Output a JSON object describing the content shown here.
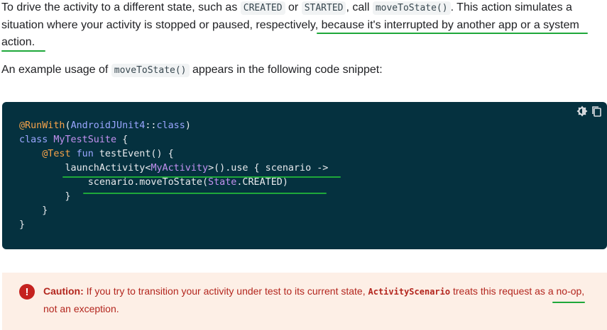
{
  "para1": {
    "t1": "To drive the activity to a different state, such as ",
    "code1": "CREATED",
    "t2": " or ",
    "code2": "STARTED",
    "t3": ", call ",
    "code3": "moveToState()",
    "t4": ". This action simulates a situation where your activity is stopped or paused, respectively, because it's interrupted by another app or a system action."
  },
  "para2": {
    "t1": "An example usage of ",
    "code1": "moveToState()",
    "t2": " appears in the following code snippet:"
  },
  "code_block": {
    "lines": [
      [
        [
          "ann",
          "@RunWith"
        ],
        [
          "pln",
          "("
        ],
        [
          "kw",
          "AndroidJUnit4"
        ],
        [
          "pln",
          "::"
        ],
        [
          "kw",
          "class"
        ],
        [
          "pln",
          ")"
        ]
      ],
      [
        [
          "kw",
          "class"
        ],
        [
          "pln",
          " "
        ],
        [
          "typ",
          "MyTestSuite"
        ],
        [
          "pln",
          " {"
        ]
      ],
      [
        [
          "pln",
          "    "
        ],
        [
          "ann",
          "@Test"
        ],
        [
          "pln",
          " "
        ],
        [
          "kw",
          "fun"
        ],
        [
          "pln",
          " testEvent() {"
        ]
      ],
      [
        [
          "pln",
          "        launchActivity<"
        ],
        [
          "typ",
          "MyActivity"
        ],
        [
          "pln",
          ">().use { scenario ->"
        ]
      ],
      [
        [
          "pln",
          "            scenario.moveToState("
        ],
        [
          "typ",
          "State"
        ],
        [
          "pln",
          ".CREATED)"
        ]
      ],
      [
        [
          "pln",
          "        }"
        ]
      ],
      [
        [
          "pln",
          "    }"
        ]
      ],
      [
        [
          "pln",
          "}"
        ]
      ]
    ],
    "theme_icon": "theme-toggle-icon",
    "copy_icon": "copy-icon"
  },
  "caution": {
    "icon": "!",
    "label": "Caution:",
    "t1": " If you try to transition your activity under test to its current state, ",
    "code": "ActivityScenario",
    "t2": " treats this request as a no-op, not an exception."
  },
  "colors": {
    "annotation_green": "#1ea83a",
    "code_bg": "#05313f",
    "caution_bg": "#fdefe6",
    "caution_text": "#b3261e"
  }
}
